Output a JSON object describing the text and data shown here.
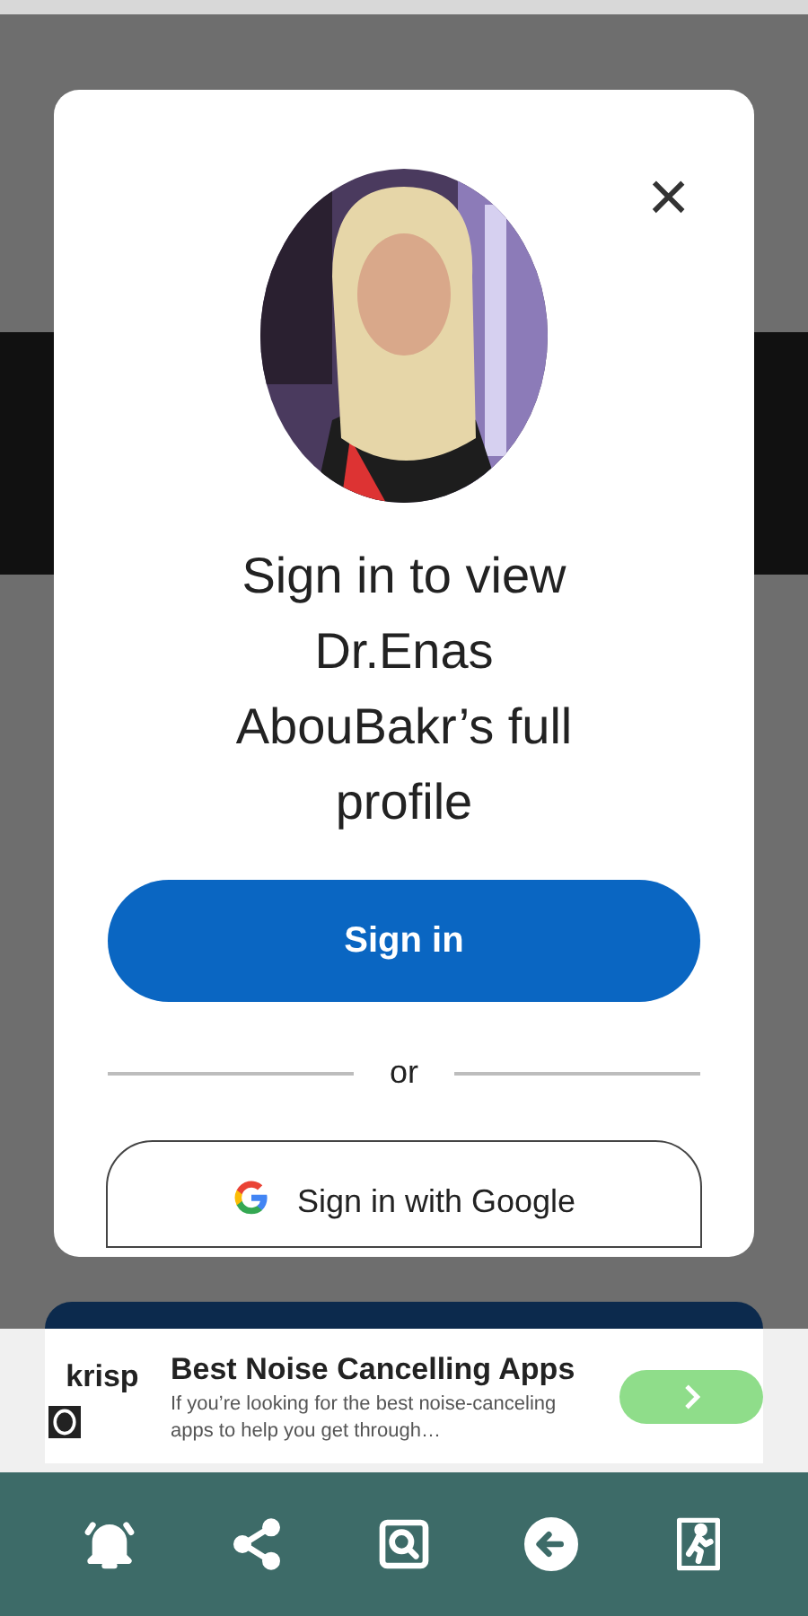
{
  "dialog": {
    "close": "×",
    "title": "Sign in to view Dr.Enas AbouBakr’s full profile",
    "primary_button": "Sign in",
    "divider": "or",
    "google_button": "Sign in with Google"
  },
  "ad": {
    "brand": "krisp",
    "title": "Best Noise Cancelling Apps",
    "body": "If you’re looking for the best noise-canceling apps to help you get through…"
  },
  "bottom_nav": [
    {
      "kind": "bell"
    },
    {
      "kind": "share"
    },
    {
      "kind": "search"
    },
    {
      "kind": "back"
    },
    {
      "kind": "exit"
    }
  ]
}
